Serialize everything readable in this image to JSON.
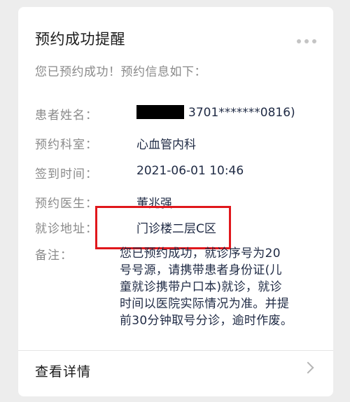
{
  "card": {
    "title": "预约成功提醒",
    "subtitle": "您已预约成功！预约信息如下：",
    "fields": [
      {
        "label": "患者姓名：",
        "value": "3701*******0816)"
      },
      {
        "label": "预约科室：",
        "value": "心血管内科"
      },
      {
        "label": "签到时间：",
        "value": "2021-06-01 10:46"
      },
      {
        "label": "预约医生：",
        "value": "董兆强"
      },
      {
        "label": "就诊地址：",
        "value": "门诊楼二层C区"
      }
    ],
    "remark": {
      "label": "备注：",
      "text": "您已预约成功，就诊序号为20\n号号源，请携带患者身份证(儿\n童就诊携带户口本)就诊，就诊\n时间以医院实际情况为准。并提\n前30分钟取号分诊，逾时作废。"
    },
    "details_link": "查看详情",
    "highlight_color": "#e0171c"
  }
}
